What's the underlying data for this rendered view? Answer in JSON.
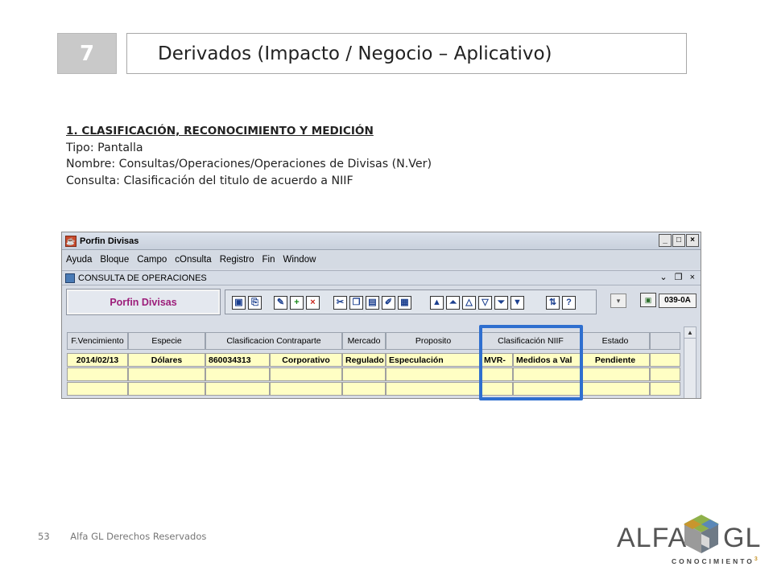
{
  "slide": {
    "number": "7",
    "title": "Derivados (Impacto / Negocio – Aplicativo)"
  },
  "description": {
    "heading": "1. CLASIFICACIÓN, RECONOCIMIENTO Y MEDICIÓN",
    "tipo": "Tipo: Pantalla",
    "nombre": "Nombre: Consultas/Operaciones/Operaciones de Divisas (N.Ver)",
    "consulta": "Consulta: Clasificación del titulo de acuerdo a NIIF"
  },
  "app": {
    "window_title": "Porfin Divisas",
    "menu": [
      "Ayuda",
      "Bloque",
      "Campo",
      "cOnsulta",
      "Registro",
      "Fin",
      "Window"
    ],
    "subwindow_title": "CONSULTA DE OPERACIONES",
    "module_name": "Porfin Divisas",
    "form_code": "039-0A",
    "module_color": "#9c1d7a",
    "grid": {
      "headers": [
        "F.Vencimiento",
        "Especie",
        "Clasificacion Contraparte",
        "Mercado",
        "Proposito",
        "Clasificación NIIF",
        "Estado"
      ],
      "row": {
        "vencimiento": "2014/02/13",
        "especie": "Dólares",
        "nit": "860034313",
        "contraparte": "Corporativo",
        "mercado": "Regulado",
        "proposito": "Especulación",
        "niif_code": "MVR-",
        "niif_desc": "Medidos a Val",
        "estado": "Pendiente"
      }
    },
    "highlight_color": "#2f6fcf"
  },
  "footer": {
    "page": "53",
    "text": "Alfa GL Derechos Reservados"
  },
  "logo": {
    "left": "ALFA",
    "right": "GL",
    "sub": "CONOCIMIENTO",
    "sup": "3"
  }
}
